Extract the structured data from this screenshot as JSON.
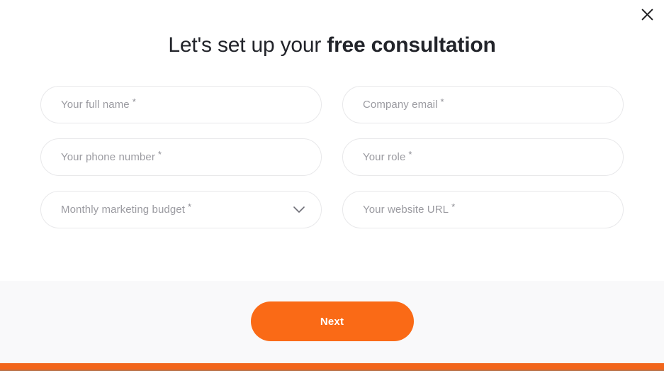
{
  "modal": {
    "close_icon": "close-icon",
    "title": {
      "normal": "Let's set up your ",
      "strong": "free consultation"
    },
    "fields": [
      {
        "name": "full-name",
        "label": "Your full name",
        "required_mark": "*",
        "type": "text",
        "value": "",
        "placeholder": "Your full name"
      },
      {
        "name": "company-email",
        "label": "Company email",
        "required_mark": "*",
        "type": "email",
        "value": "",
        "placeholder": "Company email"
      },
      {
        "name": "phone-number",
        "label": "Your phone number",
        "required_mark": "*",
        "type": "tel",
        "value": "",
        "placeholder": "Your phone number"
      },
      {
        "name": "role",
        "label": "Your role",
        "required_mark": "*",
        "type": "text",
        "value": "",
        "placeholder": "Your role"
      },
      {
        "name": "monthly-marketing-budget",
        "label": "Monthly marketing budget",
        "required_mark": "*",
        "type": "select",
        "value": "",
        "placeholder": "Monthly marketing budget",
        "icon": "chevron-down-icon"
      },
      {
        "name": "website-url",
        "label": "Your website URL",
        "required_mark": "*",
        "type": "url",
        "value": "",
        "placeholder": "Your website URL"
      }
    ],
    "footer": {
      "next_label": "Next"
    }
  },
  "colors": {
    "accent_orange": "#FA6A16",
    "bottom_bar_orange": "#F2661B",
    "title_dark": "#22242A",
    "placeholder_gray": "#9B9BA1",
    "field_border": "#E8E8EA",
    "footer_bg": "#F9F9FA"
  }
}
